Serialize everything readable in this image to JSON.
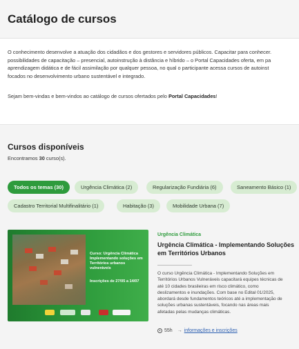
{
  "header": {
    "title": "Catálogo de cursos"
  },
  "intro": {
    "lines": [
      "O conhecimento desenvolve a atuação dos cidadãos e dos gestores e servidores públicos. Capacitar para conhecer.",
      "possibilidades de capacitação – presencial, autoinstrução à distância e híbrido – o Portal Capacidades oferta, em pa",
      "aprendizagem didática e de fácil assimilação por qualquer pessoa, no qual o participante acessa cursos de autoinst",
      "focados no desenvolvimento urbano sustentável e integrado."
    ],
    "welcome_prefix": "Sejam bem-vindas e bem-vindos ao catálogo de cursos ofertados pelo",
    "welcome_bold": "Portal Capacidades",
    "welcome_suffix": "!"
  },
  "courses": {
    "title": "Cursos disponíveis",
    "found_prefix": "Encontramos",
    "found_count": "30",
    "found_suffix": "curso(s).",
    "filters": [
      "Todos os temas (30)",
      "Urgência Climática (2)",
      "Regularização Fundiária (6)",
      "Saneamento Básico (1)",
      "Cadastro Territorial Multifinalitário (1)",
      "Habitação (3)",
      "Mobilidade Urbana (7)"
    ]
  },
  "card": {
    "category": "Urgência Climática",
    "title": "Urgência Climática - Implementando Soluções em Territórios Urbanos",
    "image_text": "Curso: Urgência Climática Implementando soluções em Territórios urbanos vulneráveis",
    "image_date": "Inscrições de 27/05 a 14/07",
    "description": [
      "O curso Urgência Climática - Implementando Soluções em",
      "Territórios Urbanos Vulneráveis capacitará equipes técnicas de",
      "até 10 cidades brasileiras em risco climático, como",
      "deslizamentos e inundações. Com base no Edital 01/2025,",
      "abordará desde fundamentos teóricos até a implementação de",
      "soluções urbanas sustentáveis, focando nas áreas mais",
      "afetadas pelas mudanças climáticas."
    ],
    "duration": "55h",
    "info_link": "informações e inscrições",
    "icons": {
      "duration": "clock-icon",
      "link": "arrow-right-icon"
    }
  },
  "colors": {
    "accent": "#2e9b3c",
    "chip_bg": "#d7ecd2",
    "link": "#2a5db0"
  }
}
